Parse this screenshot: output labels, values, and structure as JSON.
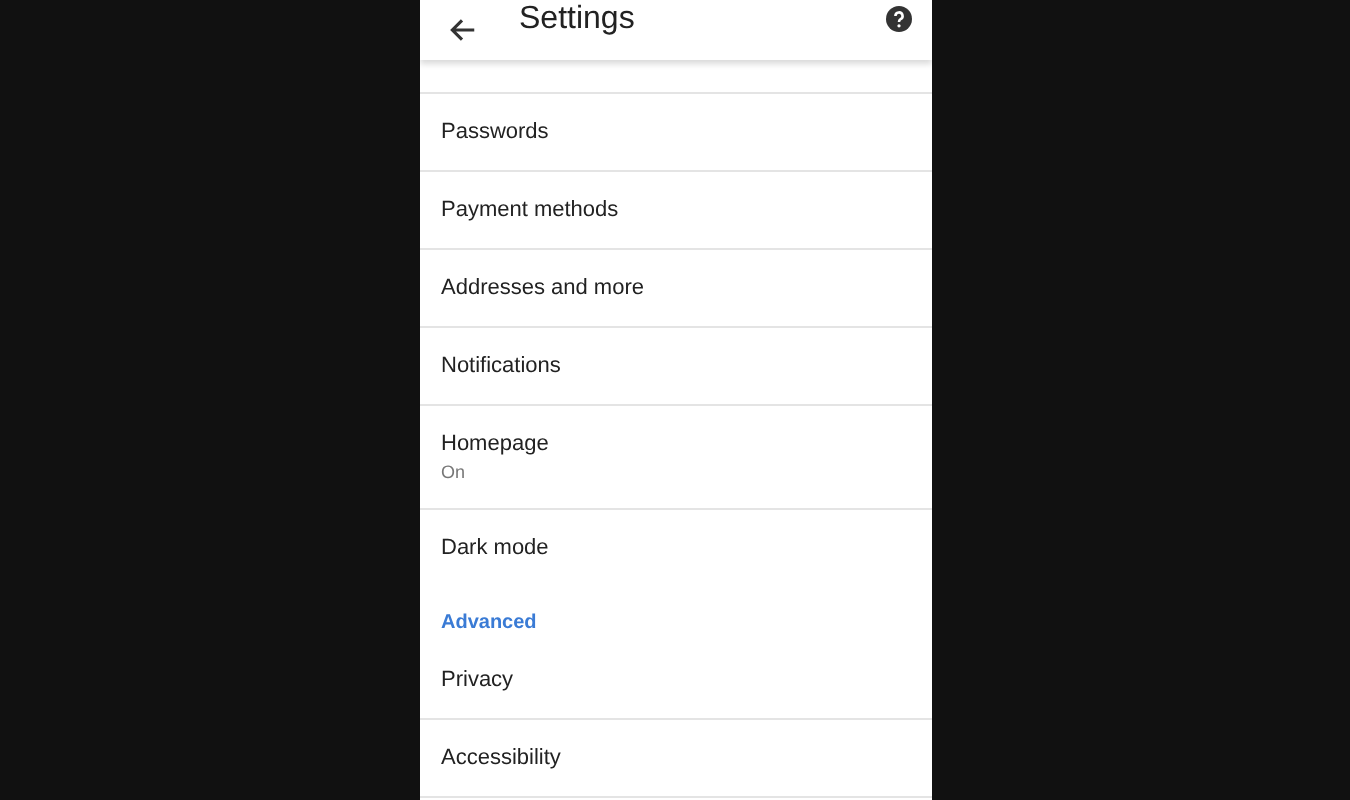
{
  "app_bar": {
    "title": "Settings"
  },
  "items": [
    {
      "kind": "item",
      "label": "Passwords"
    },
    {
      "kind": "item",
      "label": "Payment methods"
    },
    {
      "kind": "item",
      "label": "Addresses and more"
    },
    {
      "kind": "item",
      "label": "Notifications"
    },
    {
      "kind": "item",
      "label": "Homepage",
      "summary": "On"
    },
    {
      "kind": "item",
      "label": "Dark mode",
      "divider": false
    },
    {
      "kind": "section",
      "label": "Advanced"
    },
    {
      "kind": "item",
      "label": "Privacy"
    },
    {
      "kind": "item",
      "label": "Accessibility"
    }
  ]
}
